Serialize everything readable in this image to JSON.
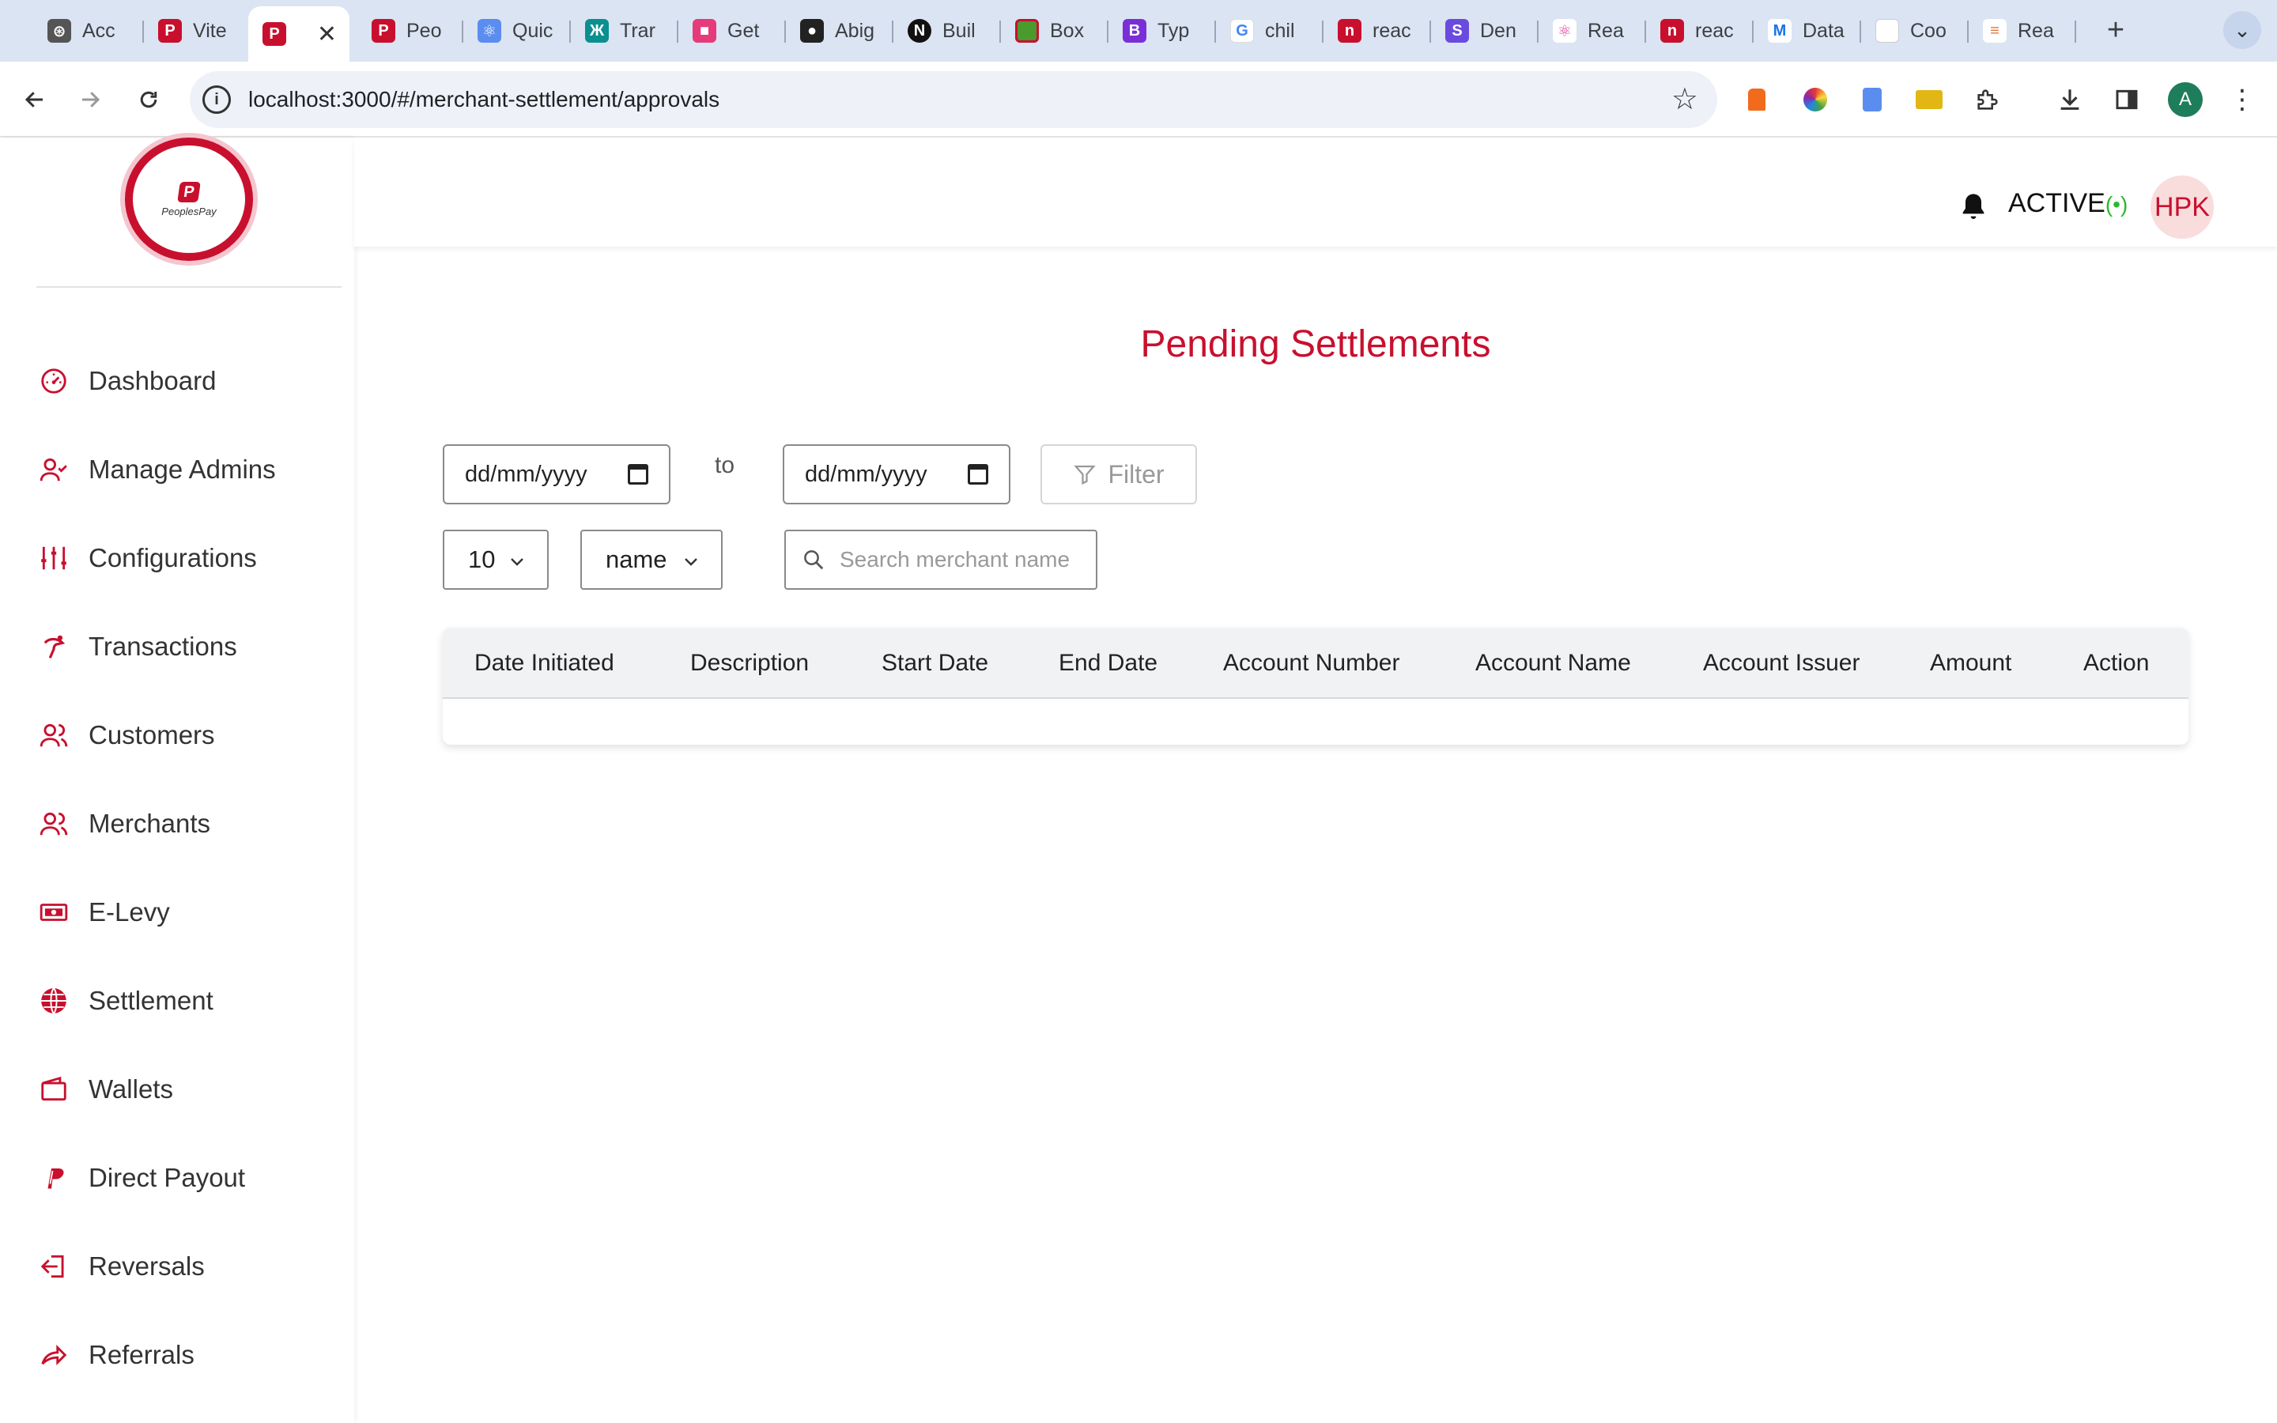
{
  "browser": {
    "tabs": [
      {
        "title": "Acc",
        "color": "#333333",
        "glyph": "⊛"
      },
      {
        "title": "Vite",
        "color": "#c8102e",
        "glyph": "P"
      },
      {
        "title": "",
        "color": "#c8102e",
        "glyph": "P",
        "active": true
      },
      {
        "title": "Peo",
        "color": "#c8102e",
        "glyph": "P"
      },
      {
        "title": "Quic",
        "color": "#5b8def",
        "glyph": "⚛"
      },
      {
        "title": "Trar",
        "color": "#0b8f8f",
        "glyph": "Ж"
      },
      {
        "title": "Get",
        "color": "#e63b7a",
        "glyph": "■"
      },
      {
        "title": "Abig",
        "color": "#222222",
        "glyph": "●"
      },
      {
        "title": "Buil",
        "color": "#111111",
        "glyph": "N"
      },
      {
        "title": "Box",
        "color": "#4a9a2e",
        "glyph": "■"
      },
      {
        "title": "Typ",
        "color": "#7a2fd6",
        "glyph": "B"
      },
      {
        "title": "chil",
        "color": "#4285f4",
        "glyph": "G"
      },
      {
        "title": "reac",
        "color": "#c8102e",
        "glyph": "n"
      },
      {
        "title": "Den",
        "color": "#6a4be0",
        "glyph": "S"
      },
      {
        "title": "Rea",
        "color": "#e0409a",
        "glyph": "⚛"
      },
      {
        "title": "reac",
        "color": "#c8102e",
        "glyph": "n"
      },
      {
        "title": "Data",
        "color": "#1a73e8",
        "glyph": "M"
      },
      {
        "title": "Coo",
        "color": "#cccccc",
        "glyph": "□"
      },
      {
        "title": "Rea",
        "color": "#e8743b",
        "glyph": "≡"
      }
    ],
    "close_glyph": "✕",
    "new_tab_glyph": "+",
    "tab_menu_glyph": "⌄",
    "url": "localhost:3000/#/merchant-settlement/approvals",
    "profile_initial": "A"
  },
  "sidebar": {
    "logo_text": "PeoplesPay",
    "logo_mark": "P",
    "items": [
      {
        "label": "Dashboard",
        "icon": "gauge-icon"
      },
      {
        "label": "Manage Admins",
        "icon": "user-check-icon"
      },
      {
        "label": "Configurations",
        "icon": "sliders-icon"
      },
      {
        "label": "Transactions",
        "icon": "hand-coin-icon"
      },
      {
        "label": "Customers",
        "icon": "users-icon"
      },
      {
        "label": "Merchants",
        "icon": "users-icon"
      },
      {
        "label": "E-Levy",
        "icon": "banknote-icon"
      },
      {
        "label": "Settlement",
        "icon": "globe-icon"
      },
      {
        "label": "Wallets",
        "icon": "wallet-icon"
      },
      {
        "label": "Direct Payout",
        "icon": "paypal-icon"
      },
      {
        "label": "Reversals",
        "icon": "sign-in-icon"
      },
      {
        "label": "Referrals",
        "icon": "share-arrow-icon"
      }
    ]
  },
  "header": {
    "status": "ACTIVE",
    "status_wave": "(•)",
    "avatar_initials": "HPK"
  },
  "main": {
    "title": "Pending Settlements",
    "date_from": "dd/mm/yyyy",
    "to_label": "to",
    "date_to": "dd/mm/yyyy",
    "filter_label": "Filter",
    "page_size": "10",
    "sort_field": "name",
    "search_placeholder": "Search merchant name"
  },
  "table": {
    "columns": [
      "Date Initiated",
      "Description",
      "Start Date",
      "End Date",
      "Account Number",
      "Account Name",
      "Account Issuer",
      "Amount",
      "Action"
    ],
    "rows": []
  },
  "colors": {
    "brand": "#c8102e",
    "active_indicator": "#2eb82e"
  }
}
